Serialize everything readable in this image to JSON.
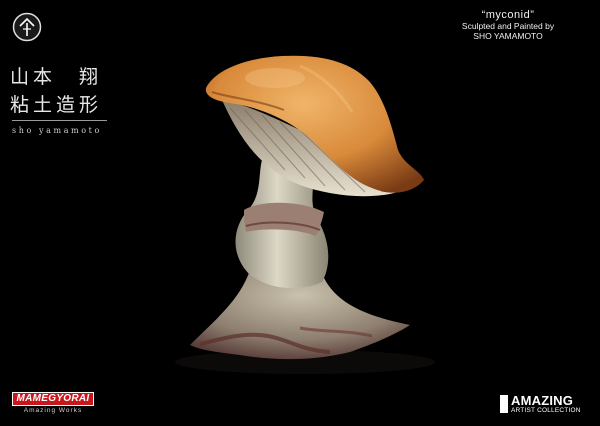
{
  "artist": {
    "name_jp_line1": "山本　翔",
    "name_jp_line2": "粘土造形",
    "name_romaji": "sho yamamoto",
    "mark_glyph": "个"
  },
  "caption": {
    "title": "“myconid”",
    "line1": "Sculpted and Painted by",
    "line2": "SHO YAMAMOTO"
  },
  "brands": {
    "left_logo": "MAMEGYORAI",
    "left_sub": "Amazing Works",
    "right_logo": "AMAZING",
    "right_sub": "ARTIST COLLECTION"
  },
  "photo": {
    "subject": "mushroom-creature-figure",
    "colors": {
      "background": "#000000",
      "cap": "#d98a3a",
      "stem": "#cfc9b8",
      "accent_red": "#c8161d"
    }
  }
}
